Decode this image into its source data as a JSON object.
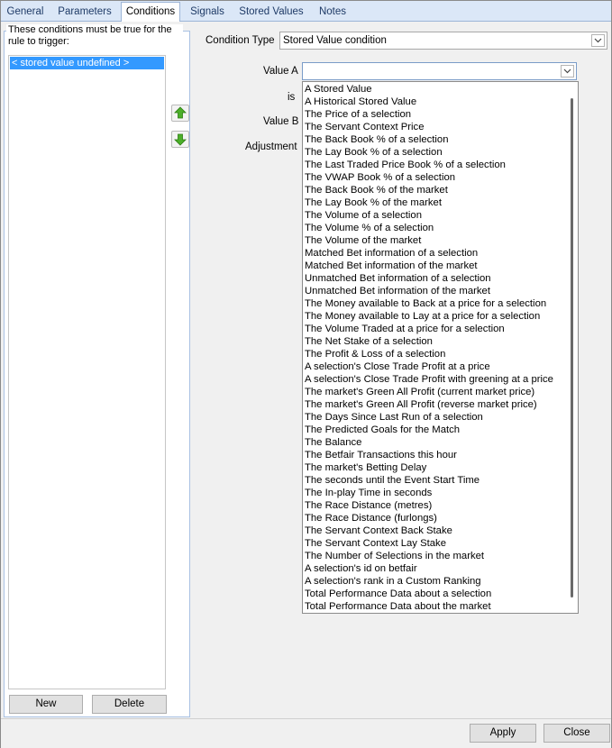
{
  "tabs": [
    "General",
    "Parameters",
    "Conditions",
    "Signals",
    "Stored Values",
    "Notes"
  ],
  "active_tab": "Conditions",
  "conditions_panel": {
    "caption": "These conditions must be true for the rule to trigger:",
    "items": [
      "< stored value undefined >"
    ],
    "new_label": "New",
    "delete_label": "Delete"
  },
  "form": {
    "condition_type_label": "Condition Type",
    "condition_type_value": "Stored Value condition",
    "value_a_label": "Value A",
    "value_a_value": "",
    "is_label": "is",
    "value_b_label": "Value B",
    "adjustment_label": "Adjustment"
  },
  "value_a_options": [
    "A Stored Value",
    "A Historical Stored Value",
    "The Price of a selection",
    "The Servant Context Price",
    "The Back Book % of a selection",
    "The Lay Book % of a selection",
    "The Last Traded Price Book % of a selection",
    "The VWAP Book % of a selection",
    "The Back Book % of the market",
    "The Lay Book % of the market",
    "The Volume of a selection",
    "The Volume % of a selection",
    "The Volume of the market",
    "Matched Bet information of a selection",
    "Matched Bet information of the market",
    "Unmatched Bet information of a selection",
    "Unmatched Bet information of the market",
    "The Money available to Back at a price for a selection",
    "The Money available to Lay at a price for a selection",
    "The Volume Traded at a price for a selection",
    "The Net Stake of a selection",
    "The Profit & Loss of a selection",
    "A selection's Close Trade Profit at a price",
    "A selection's Close Trade Profit with greening at a price",
    "The market's Green All Profit (current market price)",
    "The market's Green All Profit (reverse market price)",
    "The Days Since Last Run of a selection",
    "The Predicted Goals for the Match",
    "The Balance",
    "The Betfair Transactions this hour",
    "The market's Betting Delay",
    "The seconds until the Event Start Time",
    "The In-play Time in seconds",
    "The Race Distance (metres)",
    "The Race Distance (furlongs)",
    "The Servant Context Back Stake",
    "The Servant Context Lay Stake",
    "The Number of Selections in the market",
    "A selection's id on betfair",
    "A selection's rank in a Custom Ranking",
    "Total Performance Data about a selection",
    "Total Performance Data about the market"
  ],
  "footer": {
    "apply_label": "Apply",
    "close_label": "Close"
  },
  "colors": {
    "selection": "#3399ff",
    "tab_bar": "#dbe7f7",
    "arrow_up": "#4caf2a",
    "arrow_down": "#4caf2a"
  },
  "icons": [
    "move-up-arrow-icon",
    "move-down-arrow-icon",
    "chevron-down-icon"
  ]
}
